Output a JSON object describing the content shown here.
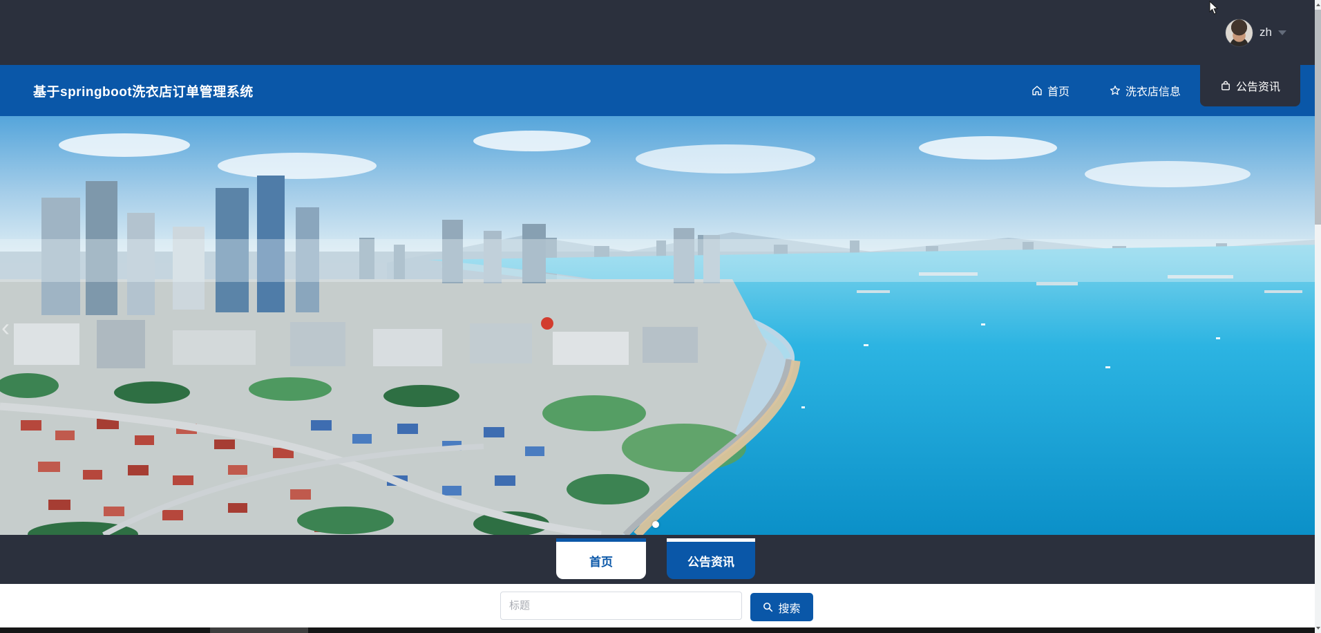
{
  "topbar": {
    "username": "zh"
  },
  "navbar": {
    "title": "基于springboot洗衣店订单管理系统",
    "items": [
      {
        "label": "首页",
        "icon": "home",
        "active": false
      },
      {
        "label": "洗衣店信息",
        "icon": "star",
        "active": false
      },
      {
        "label": "公告资讯",
        "icon": "bag",
        "active": true
      }
    ]
  },
  "hero": {
    "type": "carousel",
    "subject": "coastal-city-aerial-photo",
    "indicator_count": 1
  },
  "content_tabs": [
    {
      "label": "首页",
      "active": false
    },
    {
      "label": "公告资讯",
      "active": true
    }
  ],
  "search": {
    "placeholder": "标题",
    "button_label": "搜索"
  },
  "colors": {
    "primary_blue": "#0a57a8",
    "dark_navy": "#2b303d",
    "sea_cyan": "#12a5da",
    "bottom_strip": "#161616"
  }
}
